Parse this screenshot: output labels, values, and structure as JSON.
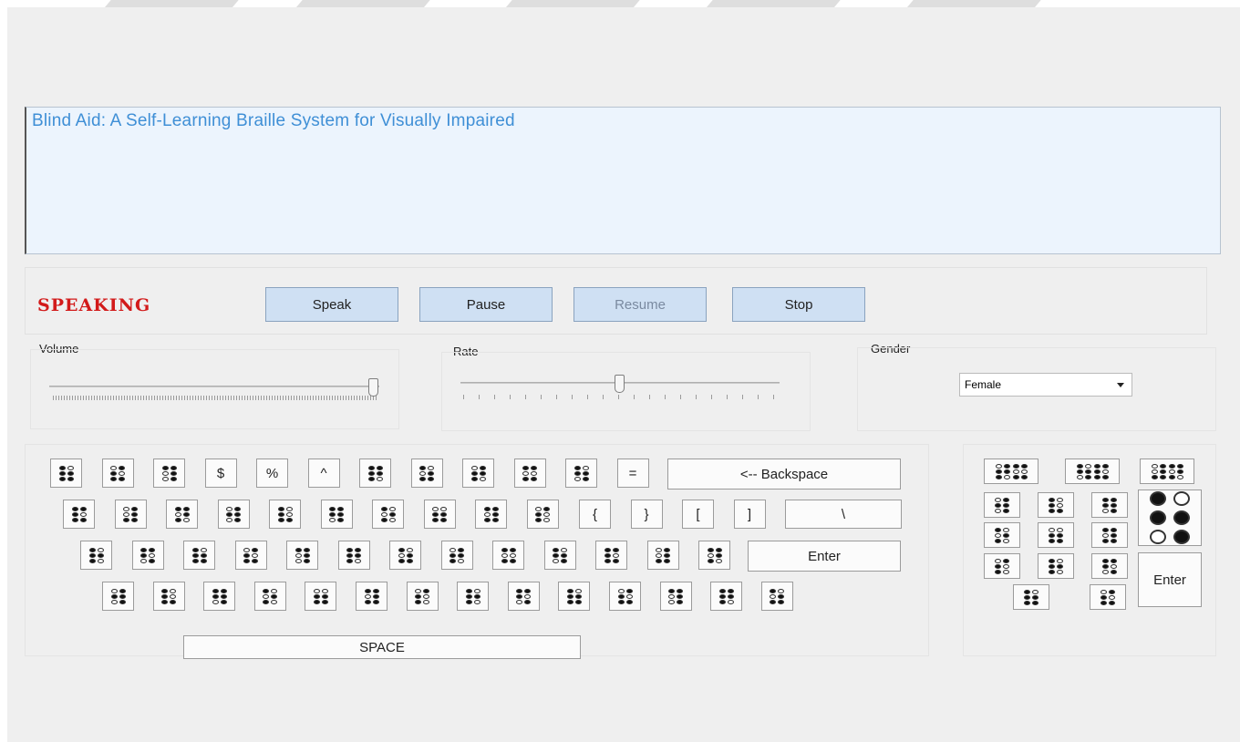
{
  "textarea": {
    "text": "Blind Aid: A Self-Learning Braille System for Visually Impaired"
  },
  "speaking_label": "SPEAKING",
  "controls": {
    "speak": "Speak",
    "pause": "Pause",
    "resume": "Resume",
    "stop": "Stop"
  },
  "volume": {
    "label": "Volume",
    "level": 1.0
  },
  "rate": {
    "label": "Rate",
    "level": 0.5
  },
  "gender": {
    "label": "Gender",
    "selected": "Female"
  },
  "keyboard": {
    "row1_symbols": [
      "$",
      "%",
      "^",
      "="
    ],
    "backspace": "<--   Backspace",
    "row2_symbols": [
      "{",
      "}",
      "[",
      "]",
      "\\"
    ],
    "enter": "Enter",
    "space": "SPACE"
  },
  "mini_pad": {
    "enter": "Enter"
  },
  "colors": {
    "title_text": "#3f8fd6",
    "speaking": "#d21a1a",
    "button": "#cfe0f3"
  }
}
